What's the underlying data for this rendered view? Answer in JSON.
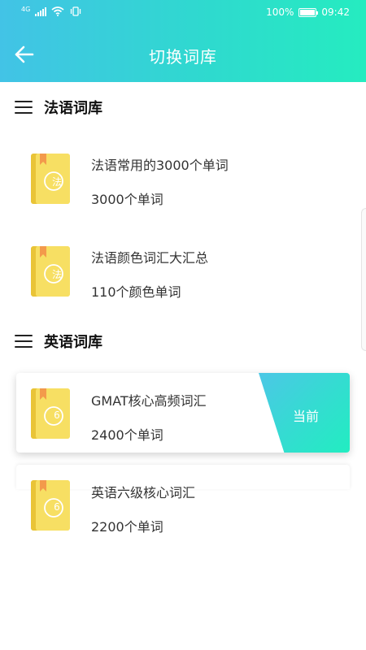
{
  "status_bar": {
    "network": "4G",
    "battery": "100%",
    "time": "09:42"
  },
  "nav": {
    "title": "切换词库"
  },
  "colors": {
    "accent_start": "#42c3e6",
    "accent_end": "#25ecc0",
    "book_yellow": "#f6dc55",
    "bookmark_orange": "#f39a4b"
  },
  "sections": [
    {
      "title": "法语词库",
      "books": [
        {
          "badge": "法",
          "title": "法语常用的3000个单词",
          "subtitle": "3000个单词",
          "current": false
        },
        {
          "badge": "法",
          "title": "法语颜色词汇大汇总",
          "subtitle": "110个颜色单词",
          "current": false
        }
      ]
    },
    {
      "title": "英语词库",
      "books": [
        {
          "badge": "6",
          "title": "GMAT核心高频词汇",
          "subtitle": "2400个单词",
          "current": true,
          "current_label": "当前"
        },
        {
          "badge": "6",
          "title": "英语六级核心词汇",
          "subtitle": "2200个单词",
          "current": false
        }
      ]
    }
  ]
}
